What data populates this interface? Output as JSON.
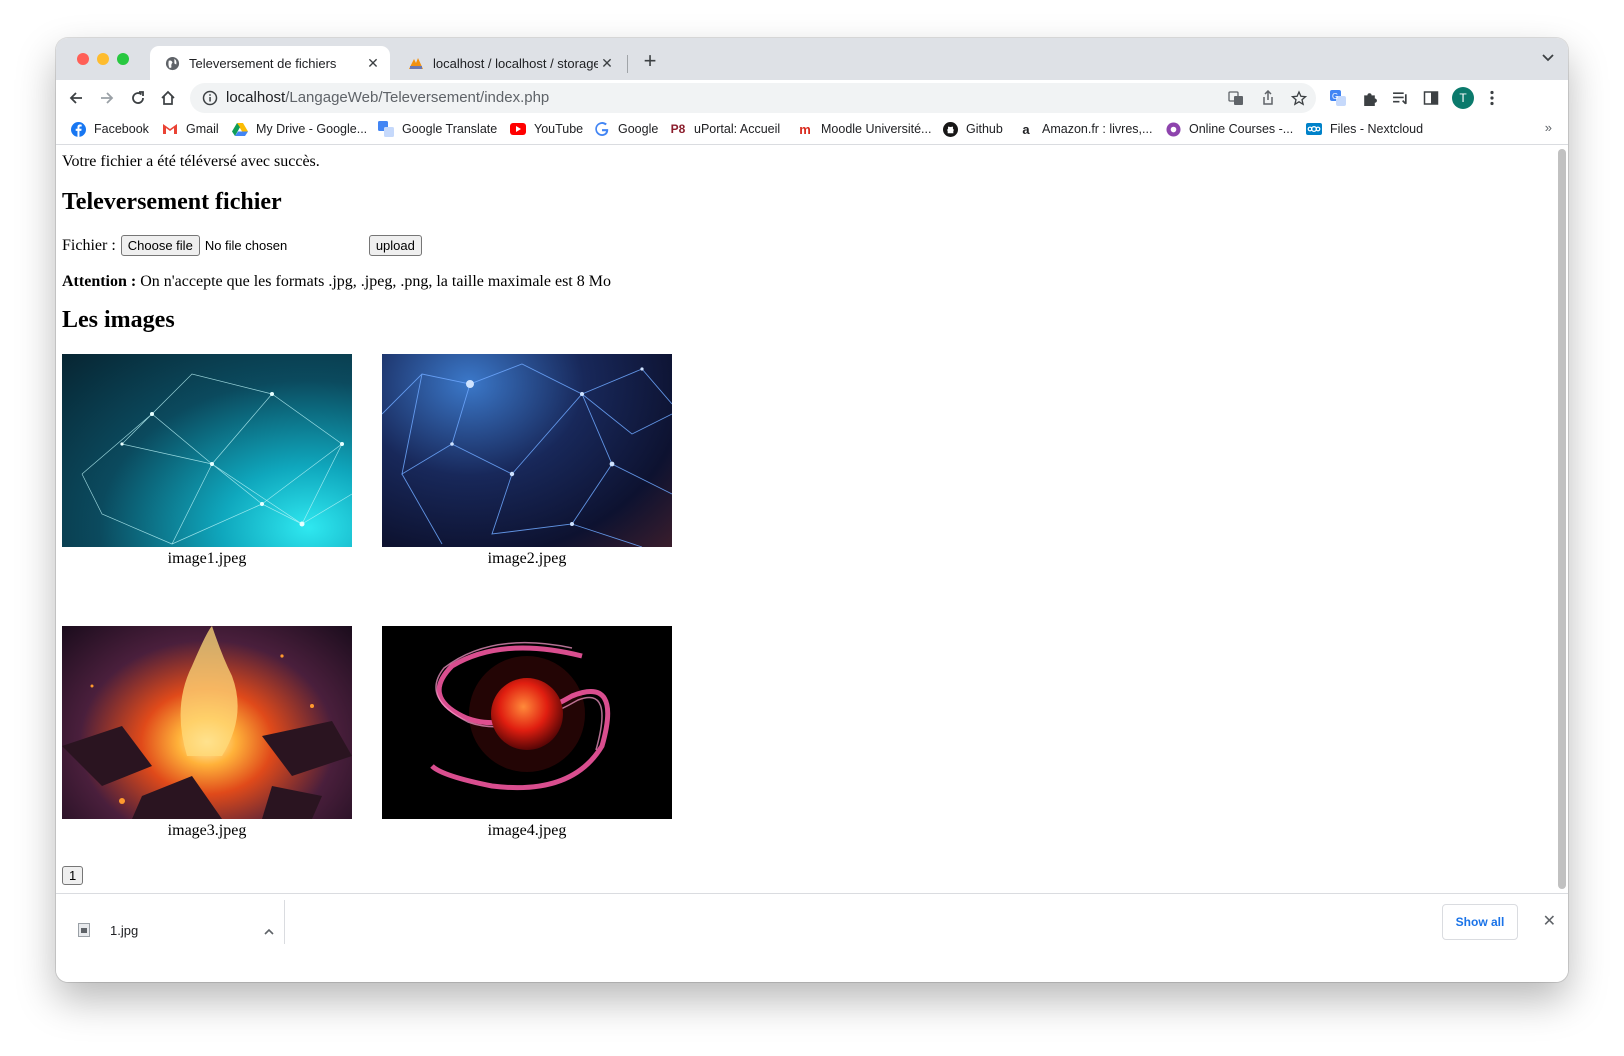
{
  "browser": {
    "tabs": [
      {
        "title": "Televersement de fichiers",
        "active": true
      },
      {
        "title": "localhost / localhost / storage /",
        "active": false
      }
    ],
    "new_tab": "+",
    "url_host": "localhost",
    "url_path": "/LangageWeb/Televersement/index.php",
    "profile_initial": "T",
    "bookmarks": [
      {
        "label": "Facebook",
        "icon": "facebook-icon"
      },
      {
        "label": "Gmail",
        "icon": "gmail-icon"
      },
      {
        "label": "My Drive - Google...",
        "icon": "drive-icon"
      },
      {
        "label": "Google Translate",
        "icon": "translate-icon"
      },
      {
        "label": "YouTube",
        "icon": "youtube-icon"
      },
      {
        "label": "Google",
        "icon": "google-icon"
      },
      {
        "label": "uPortal: Accueil",
        "icon": "uportal-icon"
      },
      {
        "label": "Moodle Université...",
        "icon": "moodle-icon"
      },
      {
        "label": "Github",
        "icon": "github-icon"
      },
      {
        "label": "Amazon.fr : livres,...",
        "icon": "amazon-icon"
      },
      {
        "label": "Online Courses -...",
        "icon": "courses-icon"
      },
      {
        "label": "Files - Nextcloud",
        "icon": "nextcloud-icon"
      }
    ],
    "bookmarks_more": "»"
  },
  "page": {
    "message": "Votre fichier a été téléversé avec succès.",
    "upload_heading": "Televersement fichier",
    "file_label": "Fichier :",
    "choose_file": "Choose file",
    "no_file": "No file chosen",
    "upload_button": "upload",
    "attention_label": "Attention :",
    "attention_text": "On n'accepte que les formats .jpg, .jpeg, .png, la taille maximale est 8 Mo",
    "images_heading": "Les images",
    "images": [
      {
        "caption": "image1.jpeg"
      },
      {
        "caption": "image2.jpeg"
      },
      {
        "caption": "image3.jpeg"
      },
      {
        "caption": "image4.jpeg"
      }
    ],
    "page_number": "1"
  },
  "downloads": {
    "file": "1.jpg",
    "show_all": "Show all"
  },
  "colors": {
    "tabstrip": "#dee1e6",
    "avatar": "#0b7a6c",
    "link_blue": "#1a73e8"
  }
}
